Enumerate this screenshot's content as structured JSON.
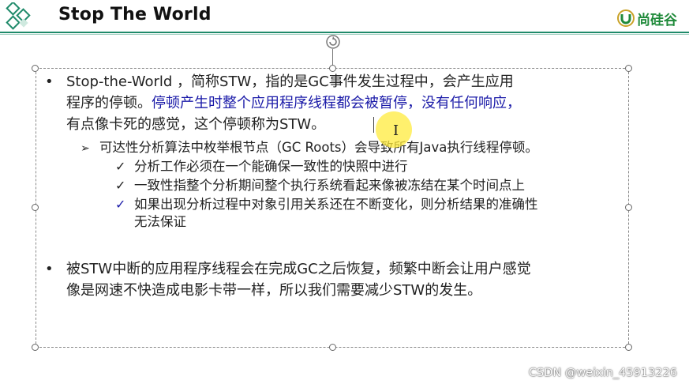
{
  "header": {
    "title": "Stop The World",
    "brand_name": "尚硅谷",
    "brand_color": "#1f8a3a",
    "rule_color": "#1f8a6a"
  },
  "bullet1": {
    "line1": "Stop-the-World ，简称STW，指的是GC事件发生过程中，会产生应用",
    "line2_black": "程序的停顿。",
    "line2_blue": "停顿产生时整个应用程序线程都会被暂停，没有任何响应，",
    "line3": "有点像卡死的感觉，这个停顿称为STW。"
  },
  "sub": {
    "arrow_item": "可达性分析算法中枚举根节点（GC Roots）会导致所有Java执行线程停顿。",
    "checks": [
      "分析工作必须在一个能确保一致性的快照中进行",
      "一致性指整个分析期间整个执行系统看起来像被冻结在某个时间点上",
      "如果出现分析过程中对象引用关系还在不断变化，则分析结果的准确性",
      "无法保证"
    ]
  },
  "bullet2": {
    "line1": "被STW中断的应用程序线程会在完成GC之后恢复，频繁中断会让用户感觉",
    "line2": "像是网速不快造成电影卡带一样，所以我们需要减少STW的发生。"
  },
  "watermark": "CSDN @weixin_45913226",
  "colors": {
    "blue_text": "#1a1aa8",
    "highlight": "#ffeb3c"
  },
  "icons": {
    "bullet": "•",
    "arrow": "➢",
    "check": "✓",
    "ibeam": "I"
  }
}
